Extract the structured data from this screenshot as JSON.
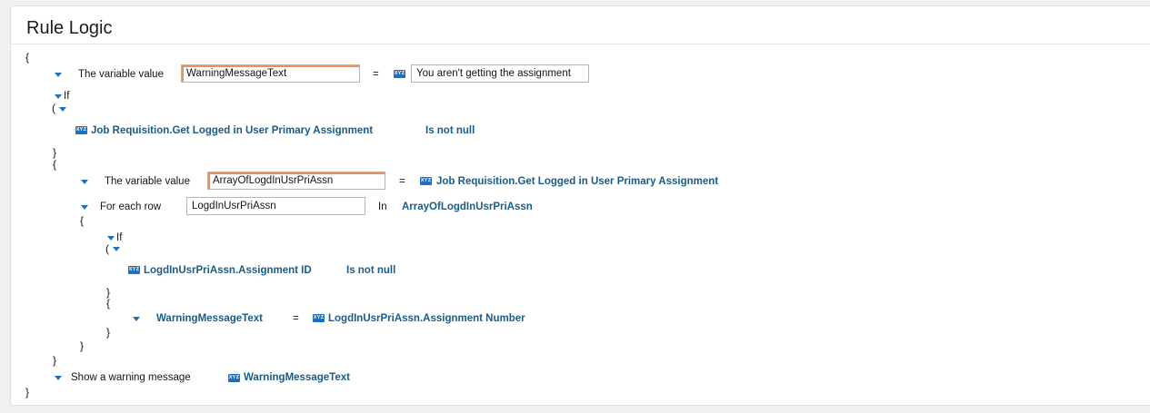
{
  "title": "Rule Logic",
  "braces": {
    "open": "{",
    "close": "}",
    "open_paren": "("
  },
  "lines": {
    "assign1_label": "The variable value",
    "assign1_var": "WarningMessageText",
    "assign1_eq": "=",
    "assign1_value": "You aren't getting the assignment",
    "if1_label": "If",
    "cond1_field": "Job Requisition.Get Logged in User Primary Assignment",
    "cond1_op": "Is not null",
    "assign2_label": "The variable value",
    "assign2_var": "ArrayOfLogdInUsrPriAssn",
    "assign2_eq": "=",
    "assign2_field": "Job Requisition.Get Logged in User Primary Assignment",
    "foreach_label": "For each row",
    "foreach_var": "LogdInUsrPriAssn",
    "foreach_in": "In",
    "foreach_collection": "ArrayOfLogdInUsrPriAssn",
    "if2_label": "If",
    "cond2_field": "LogdInUsrPriAssn.Assignment ID",
    "cond2_op": "Is not null",
    "assign3_target": "WarningMessageText",
    "assign3_eq": "=",
    "assign3_field": "LogdInUsrPriAssn.Assignment Number",
    "warn_label": "Show a warning message",
    "warn_field": "WarningMessageText"
  },
  "icons": {
    "field_icon": "field-icon",
    "expand_icon": "caret-down-icon"
  },
  "colors": {
    "accent": "#1f6fbf",
    "link": "#1a5c8a",
    "marker": "#e8925a"
  }
}
